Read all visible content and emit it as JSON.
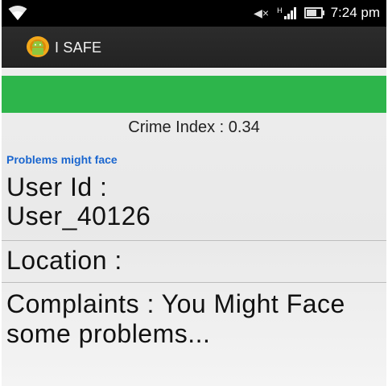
{
  "status_bar": {
    "time": "7:24 pm",
    "icons": [
      "wifi-icon",
      "mute-icon",
      "signal-icon",
      "battery-icon"
    ]
  },
  "action_bar": {
    "title": "I SAFE",
    "icon": "android-app-icon"
  },
  "colors": {
    "green_bar": "#2db54b",
    "problems_label": "#1a66cf"
  },
  "content": {
    "crime_index": "Crime Index : 0.34",
    "problems_label": "Problems might face",
    "user_id": "User Id : User_40126",
    "location": "Location :",
    "complaints": "Complaints : You Might Face some problems..."
  }
}
